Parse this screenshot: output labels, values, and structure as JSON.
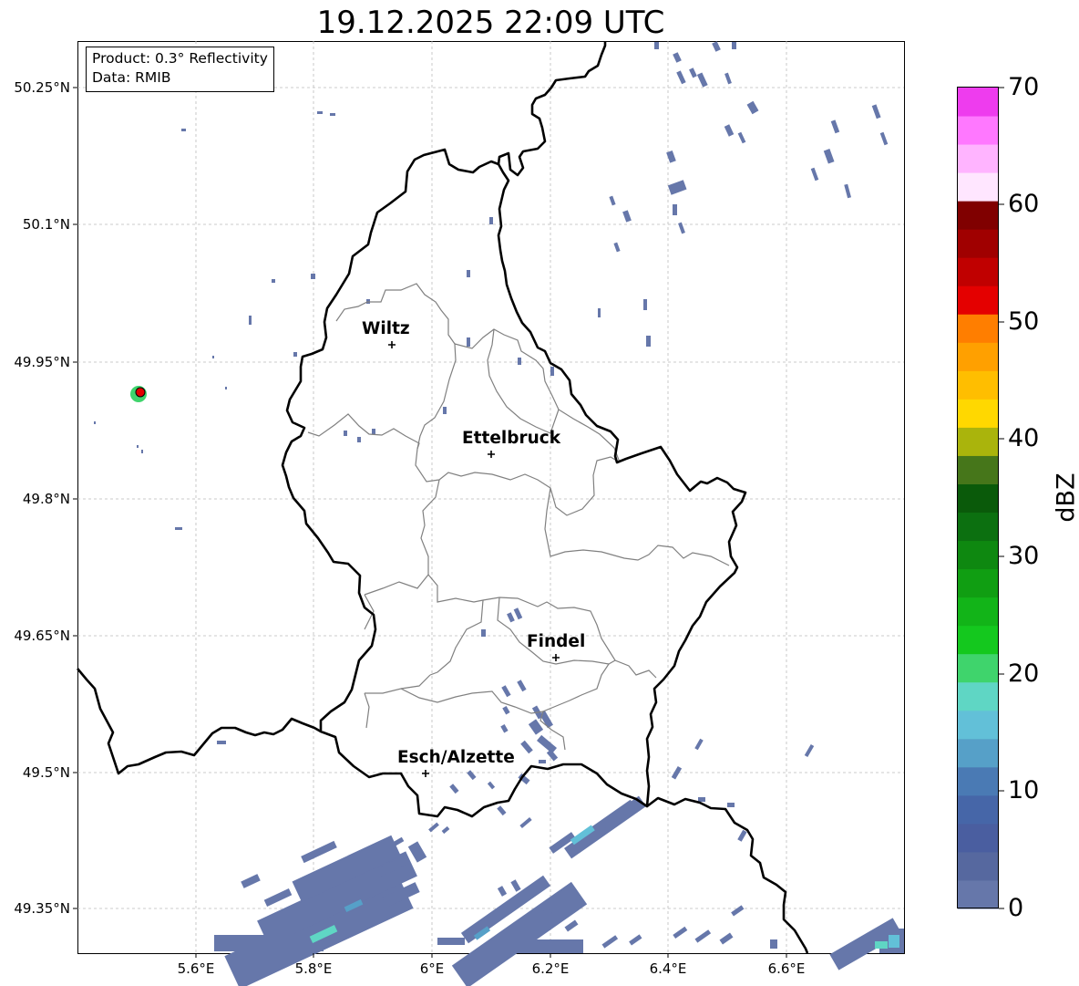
{
  "title": "19.12.2025 22:09 UTC",
  "info": {
    "product": "Product: 0.3° Reflectivity",
    "data": "Data: RMIB"
  },
  "lat_labels": [
    "50.25°N",
    "50.1°N",
    "49.95°N",
    "49.8°N",
    "49.65°N",
    "49.5°N",
    "49.35°N"
  ],
  "lon_labels": [
    "5.6°E",
    "5.8°E",
    "6°E",
    "6.2°E",
    "6.4°E",
    "6.6°E"
  ],
  "cities": [
    {
      "name": "Wiltz"
    },
    {
      "name": "Ettelbruck"
    },
    {
      "name": "Findel"
    },
    {
      "name": "Esch/Alzette"
    }
  ],
  "colorbar": {
    "label": "dBZ",
    "ticks": [
      "70",
      "60",
      "50",
      "40",
      "30",
      "20",
      "10",
      "0"
    ],
    "range": [
      0,
      70
    ],
    "colors": [
      "#6677aa",
      "#56689f",
      "#4a5ea0",
      "#4666a8",
      "#4a7ab4",
      "#56a0c8",
      "#62c0d8",
      "#5fd6c4",
      "#3fd46c",
      "#14c81e",
      "#12b418",
      "#109e12",
      "#0e8810",
      "#0c7010",
      "#0a5a0a",
      "#46761a",
      "#aab40c",
      "#ffd800",
      "#ffbe00",
      "#ffa000",
      "#ff7e00",
      "#e40000",
      "#c00000",
      "#a00000",
      "#800000",
      "#ffe6ff",
      "#ffb4ff",
      "#ff78ff",
      "#ee3cee"
    ]
  },
  "colors": {
    "radar_echo": "#6677aa",
    "border": "#000000",
    "district": "#808080",
    "grid": "#bbbbbb"
  }
}
